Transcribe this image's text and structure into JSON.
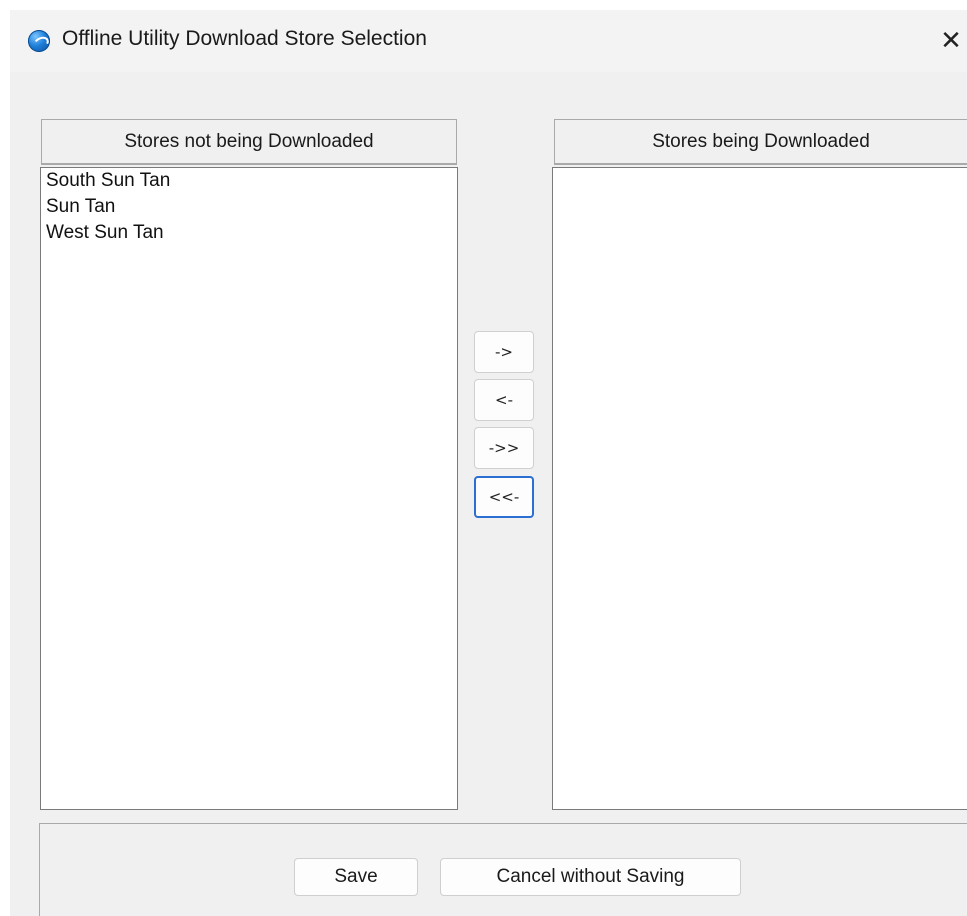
{
  "window": {
    "title": "Offline Utility Download Store Selection",
    "close_glyph": "✕"
  },
  "left_list": {
    "header": "Stores not being Downloaded",
    "items": [
      "South Sun Tan",
      "Sun Tan",
      "West Sun Tan"
    ]
  },
  "right_list": {
    "header": "Stores being Downloaded",
    "items": []
  },
  "move_buttons": {
    "move_right": "->",
    "move_left": "<-",
    "move_all_right": "->>",
    "move_all_left": "<<-"
  },
  "actions": {
    "save": "Save",
    "cancel": "Cancel without Saving"
  },
  "colors": {
    "focus_border": "#2a6fd1",
    "window_bg": "#f0f0f0"
  }
}
